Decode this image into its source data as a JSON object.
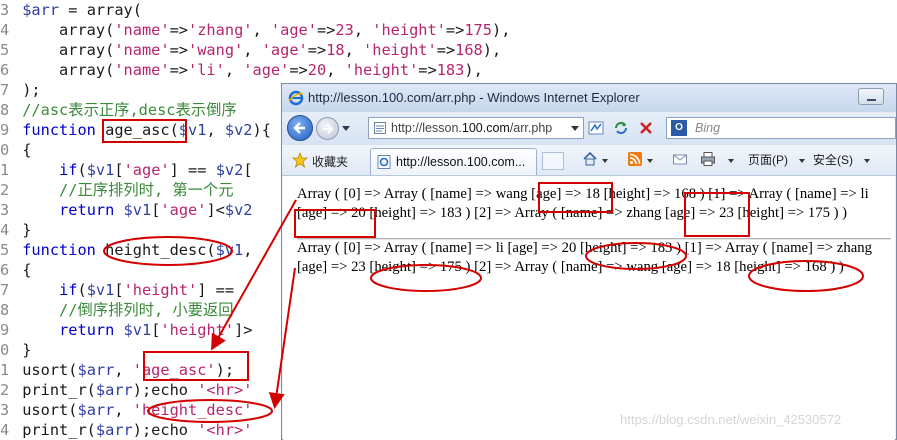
{
  "editor": {
    "lines": [
      {
        "num": "3",
        "tokens": [
          {
            "t": "var",
            "v": "$arr"
          },
          {
            "t": "plain",
            "v": " = "
          },
          {
            "t": "plain",
            "v": "array("
          }
        ]
      },
      {
        "num": "4",
        "tokens": [
          {
            "t": "plain",
            "v": "    array("
          },
          {
            "t": "str",
            "v": "'name'"
          },
          {
            "t": "plain",
            "v": "=>"
          },
          {
            "t": "str",
            "v": "'zhang'"
          },
          {
            "t": "plain",
            "v": ", "
          },
          {
            "t": "str",
            "v": "'age'"
          },
          {
            "t": "plain",
            "v": "=>"
          },
          {
            "t": "num",
            "v": "23"
          },
          {
            "t": "plain",
            "v": ", "
          },
          {
            "t": "str",
            "v": "'height'"
          },
          {
            "t": "plain",
            "v": "=>"
          },
          {
            "t": "num",
            "v": "175"
          },
          {
            "t": "plain",
            "v": "),"
          }
        ]
      },
      {
        "num": "5",
        "tokens": [
          {
            "t": "plain",
            "v": "    array("
          },
          {
            "t": "str",
            "v": "'name'"
          },
          {
            "t": "plain",
            "v": "=>"
          },
          {
            "t": "str",
            "v": "'wang'"
          },
          {
            "t": "plain",
            "v": ", "
          },
          {
            "t": "str",
            "v": "'age'"
          },
          {
            "t": "plain",
            "v": "=>"
          },
          {
            "t": "num",
            "v": "18"
          },
          {
            "t": "plain",
            "v": ", "
          },
          {
            "t": "str",
            "v": "'height'"
          },
          {
            "t": "plain",
            "v": "=>"
          },
          {
            "t": "num",
            "v": "168"
          },
          {
            "t": "plain",
            "v": "),"
          }
        ]
      },
      {
        "num": "6",
        "tokens": [
          {
            "t": "plain",
            "v": "    array("
          },
          {
            "t": "str",
            "v": "'name'"
          },
          {
            "t": "plain",
            "v": "=>"
          },
          {
            "t": "str",
            "v": "'li'"
          },
          {
            "t": "plain",
            "v": ", "
          },
          {
            "t": "str",
            "v": "'age'"
          },
          {
            "t": "plain",
            "v": "=>"
          },
          {
            "t": "num",
            "v": "20"
          },
          {
            "t": "plain",
            "v": ", "
          },
          {
            "t": "str",
            "v": "'height'"
          },
          {
            "t": "plain",
            "v": "=>"
          },
          {
            "t": "num",
            "v": "183"
          },
          {
            "t": "plain",
            "v": "),"
          }
        ]
      },
      {
        "num": "7",
        "tokens": [
          {
            "t": "plain",
            "v": ");"
          }
        ]
      },
      {
        "num": "8",
        "tokens": [
          {
            "t": "com",
            "v": "//asc表示正序,desc表示倒序"
          }
        ]
      },
      {
        "num": "9",
        "tokens": [
          {
            "t": "kw",
            "v": "function"
          },
          {
            "t": "plain",
            "v": " age_asc("
          },
          {
            "t": "var",
            "v": "$v1"
          },
          {
            "t": "plain",
            "v": ", "
          },
          {
            "t": "var",
            "v": "$v2"
          },
          {
            "t": "plain",
            "v": "){"
          }
        ]
      },
      {
        "num": "0",
        "tokens": [
          {
            "t": "plain",
            "v": "{"
          }
        ]
      },
      {
        "num": "1",
        "tokens": [
          {
            "t": "plain",
            "v": "    "
          },
          {
            "t": "kw",
            "v": "if"
          },
          {
            "t": "plain",
            "v": "("
          },
          {
            "t": "var",
            "v": "$v1"
          },
          {
            "t": "plain",
            "v": "["
          },
          {
            "t": "str",
            "v": "'age'"
          },
          {
            "t": "plain",
            "v": "] == "
          },
          {
            "t": "var",
            "v": "$v2"
          },
          {
            "t": "plain",
            "v": "["
          }
        ]
      },
      {
        "num": "2",
        "tokens": [
          {
            "t": "com",
            "v": "    //正序排列时, 第一个元"
          }
        ]
      },
      {
        "num": "3",
        "tokens": [
          {
            "t": "plain",
            "v": "    "
          },
          {
            "t": "kw",
            "v": "return"
          },
          {
            "t": "plain",
            "v": " "
          },
          {
            "t": "var",
            "v": "$v1"
          },
          {
            "t": "plain",
            "v": "["
          },
          {
            "t": "str",
            "v": "'age'"
          },
          {
            "t": "plain",
            "v": "]<"
          },
          {
            "t": "var",
            "v": "$v2"
          }
        ]
      },
      {
        "num": "4",
        "tokens": [
          {
            "t": "plain",
            "v": "}"
          }
        ]
      },
      {
        "num": "5",
        "tokens": [
          {
            "t": "kw",
            "v": "function"
          },
          {
            "t": "plain",
            "v": " height_desc("
          },
          {
            "t": "var",
            "v": "$v1"
          },
          {
            "t": "plain",
            "v": ","
          }
        ]
      },
      {
        "num": "6",
        "tokens": [
          {
            "t": "plain",
            "v": "{"
          }
        ]
      },
      {
        "num": "7",
        "tokens": [
          {
            "t": "plain",
            "v": "    "
          },
          {
            "t": "kw",
            "v": "if"
          },
          {
            "t": "plain",
            "v": "("
          },
          {
            "t": "var",
            "v": "$v1"
          },
          {
            "t": "plain",
            "v": "["
          },
          {
            "t": "str",
            "v": "'height'"
          },
          {
            "t": "plain",
            "v": "] == "
          }
        ]
      },
      {
        "num": "8",
        "tokens": [
          {
            "t": "com",
            "v": "    //倒序排列时, 小要返回"
          }
        ]
      },
      {
        "num": "9",
        "tokens": [
          {
            "t": "plain",
            "v": "    "
          },
          {
            "t": "kw",
            "v": "return"
          },
          {
            "t": "plain",
            "v": " "
          },
          {
            "t": "var",
            "v": "$v1"
          },
          {
            "t": "plain",
            "v": "["
          },
          {
            "t": "str",
            "v": "'height'"
          },
          {
            "t": "plain",
            "v": "]>"
          }
        ]
      },
      {
        "num": "0",
        "tokens": [
          {
            "t": "plain",
            "v": "}"
          }
        ]
      },
      {
        "num": "1",
        "tokens": [
          {
            "t": "plain",
            "v": "usort("
          },
          {
            "t": "var",
            "v": "$arr"
          },
          {
            "t": "plain",
            "v": ", "
          },
          {
            "t": "str",
            "v": "'age_asc'"
          },
          {
            "t": "plain",
            "v": ");"
          }
        ]
      },
      {
        "num": "2",
        "tokens": [
          {
            "t": "plain",
            "v": "print_r("
          },
          {
            "t": "var",
            "v": "$arr"
          },
          {
            "t": "plain",
            "v": ");echo "
          },
          {
            "t": "str",
            "v": "'<hr>'"
          }
        ]
      },
      {
        "num": "3",
        "tokens": [
          {
            "t": "plain",
            "v": "usort("
          },
          {
            "t": "var",
            "v": "$arr"
          },
          {
            "t": "plain",
            "v": ", "
          },
          {
            "t": "str",
            "v": "'height_desc'"
          }
        ]
      },
      {
        "num": "4",
        "tokens": [
          {
            "t": "plain",
            "v": "print_r("
          },
          {
            "t": "var",
            "v": "$arr"
          },
          {
            "t": "plain",
            "v": ");echo "
          },
          {
            "t": "str",
            "v": "'<hr>'"
          }
        ]
      }
    ]
  },
  "browser": {
    "title": "http://lesson.100.com/arr.php - Windows Internet Explorer",
    "address_prefix": "http://lesson.",
    "address_domain": "100.com",
    "address_suffix": "/arr.php",
    "search_placeholder": "Bing",
    "favorites_label": "收藏夹",
    "tab_title": "http://lesson.100.com...",
    "page_menu": "页面(P)",
    "safety_menu": "安全(S)"
  },
  "output": {
    "line1": "Array ( [0] => Array ( [name] => wang [age] => 18 [height] => 168 ) [1] => Array ( [name] => li",
    "line2": "[age] => 20 [height] => 183 ) [2] => Array ( [name] => zhang [age] => 23 [height] => 175 ) )",
    "line3": "Array ( [0] => Array ( [name] => li [age] => 20 [height] => 183 ) [1] => Array ( [name] => zhang",
    "line4": "[age] => 23 [height] => 175 ) [2] => Array ( [name] => wang [age] => 18 [height] => 168 ) )"
  },
  "watermark": "https://blog.csdn.net/weixin_42530572",
  "colors": {
    "annotation": "#d40000",
    "code_string": "#b5256f",
    "code_keyword": "#0000c8",
    "code_comment": "#3a8a3a"
  }
}
